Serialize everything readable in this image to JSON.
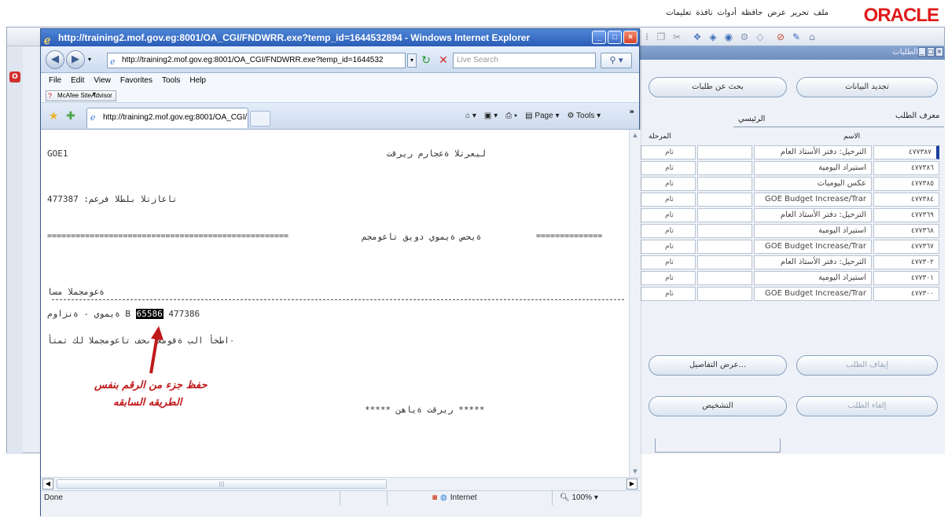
{
  "oracle": {
    "logo": "ORACLE",
    "menu": [
      "ملف",
      "تحرير",
      "عرض",
      "حافظة",
      "أدوات",
      "نافذة",
      "تعليمات"
    ],
    "left_badge": "O"
  },
  "requests_form": {
    "window_title": "الطلبات",
    "refresh_button": "تجديد البيانات",
    "find_button": "بحث عن طلبات",
    "col_request_id": "معرف الطلب",
    "col_parent": "الرئيسي",
    "col_name": "الاسم",
    "col_phase": "المرحلة",
    "rows": [
      {
        "id": "٤٧٧٣٨٧",
        "name": "الترحيل: دفتر الأستاذ العام",
        "phase": "تام"
      },
      {
        "id": "٤٧٧٣٨٦",
        "name": "استيراد اليومية",
        "phase": "تام"
      },
      {
        "id": "٤٧٧٣٨٥",
        "name": "عكس اليوميات",
        "phase": "تام"
      },
      {
        "id": "٤٧٧٣٨٤",
        "name": "GOE Budget Increase/Trar",
        "phase": "تام"
      },
      {
        "id": "٤٧٧٣٦٩",
        "name": "الترحيل: دفتر الأستاذ العام",
        "phase": "تام"
      },
      {
        "id": "٤٧٧٣٦٨",
        "name": "استيراد اليومية",
        "phase": "تام"
      },
      {
        "id": "٤٧٧٣٦٧",
        "name": "GOE Budget Increase/Trar",
        "phase": "تام"
      },
      {
        "id": "٤٧٧٣٠٢",
        "name": "الترحيل: دفتر الأستاذ العام",
        "phase": "تام"
      },
      {
        "id": "٤٧٧٣٠١",
        "name": "استيراد اليومية",
        "phase": "تام"
      },
      {
        "id": "٤٧٧٣٠٠",
        "name": "GOE Budget Increase/Trar",
        "phase": "تام"
      }
    ],
    "hold_button": "إيقاف الطلب",
    "details_button": "عرض التفاصيل...",
    "cancel_button": "إلغاء الطلب",
    "diagnostics_button": "التشخيص"
  },
  "ie": {
    "title": "http://training2.mof.gov.eg:8001/OA_CGI/FNDWRR.exe?temp_id=1644532894 - Windows Internet Explorer",
    "address": "http://training2.mof.gov.eg:8001/OA_CGI/FNDWRR.exe?temp_id=1644532",
    "search_placeholder": "Live Search",
    "menu": [
      "File",
      "Edit",
      "View",
      "Favorites",
      "Tools",
      "Help"
    ],
    "mcafee": "McAfee SiteAdvisor",
    "tab_title": "http://training2.mof.gov.eg:8001/OA_CGI/FNDWRR....",
    "tools_strip": [
      "Page",
      "Tools"
    ],
    "status_done": "Done",
    "status_zone": "Internet",
    "status_zoom": "100%"
  },
  "report": {
    "line1_left": "GOE1",
    "line1_right": "ليعرتلا ةعجارم ريرقت",
    "line2": "477387 :تاعازتلا بلطلا فرعم",
    "line3_left": "===================================================",
    "line3_mid": "ةيحص ةيموي دويق تاعومجم",
    "line3_right": "==============",
    "line4": "ةعومجملا مسا",
    "line5_prefix": "ةيموي - ةنزاوم B",
    "line5_highlight": "65586",
    "line5_suffix": "477386",
    "line6": "٠اطخأ الب ةقوملا ىحف تاعومجملا لك تمتأ",
    "footer": "***** ريرقت ةياهن *****"
  },
  "annotation": {
    "line1": "حفظ جزء من الرقم بنفس",
    "line2": "الطريقه السابقه",
    "color": "#c0181b"
  }
}
